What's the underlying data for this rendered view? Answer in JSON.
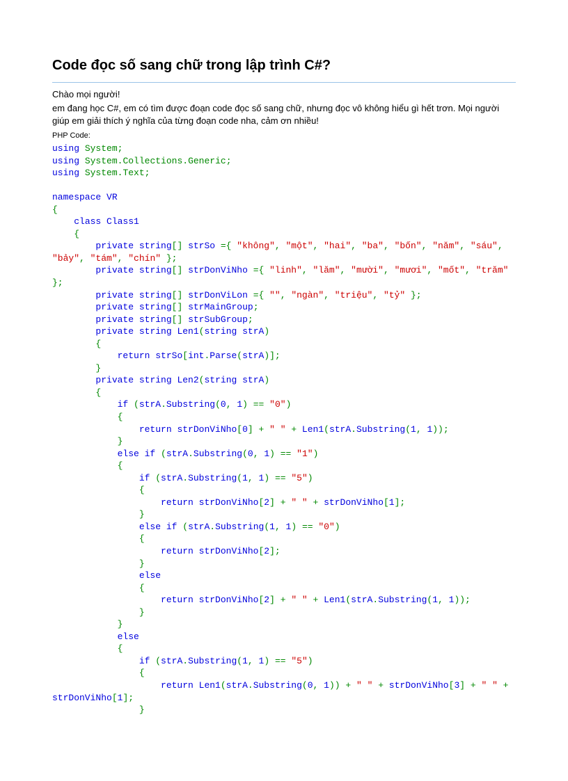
{
  "title": "Code đọc số sang chữ trong lập trình C#?",
  "intro_lines": [
    "Chào mọi người!",
    "em đang học C#, em có tìm được đoạn code đọc số sang chữ, nhưng đọc vô không hiểu gì hết trơn. Mọi người giúp em giải thích ý nghĩa của từng đoạn code nha, cảm ơn nhiều!"
  ],
  "php_label": "PHP Code:",
  "code_tokens": [
    [
      [
        "kw",
        "using"
      ],
      [
        "pl",
        " System"
      ],
      [
        "op",
        ";"
      ]
    ],
    [
      [
        "kw",
        "using"
      ],
      [
        "pl",
        " System"
      ],
      [
        "op",
        "."
      ],
      [
        "pl",
        "Collections"
      ],
      [
        "op",
        "."
      ],
      [
        "pl",
        "Generic"
      ],
      [
        "op",
        ";"
      ]
    ],
    [
      [
        "kw",
        "using"
      ],
      [
        "pl",
        " System"
      ],
      [
        "op",
        "."
      ],
      [
        "pl",
        "Text"
      ],
      [
        "op",
        ";"
      ]
    ],
    [
      [
        "",
        " "
      ]
    ],
    [
      [
        "kw",
        "namespace "
      ],
      [
        "id",
        "VR"
      ]
    ],
    [
      [
        "op",
        "{"
      ]
    ],
    [
      [
        "pl",
        "    "
      ],
      [
        "kw",
        "class "
      ],
      [
        "id",
        "Class1"
      ]
    ],
    [
      [
        "pl",
        "    "
      ],
      [
        "op",
        "{"
      ]
    ],
    [
      [
        "pl",
        "        "
      ],
      [
        "kw",
        "private "
      ],
      [
        "typ",
        "string"
      ],
      [
        "op",
        "[] "
      ],
      [
        "id",
        "strSo "
      ],
      [
        "op",
        "={ "
      ],
      [
        "str",
        "\"không\""
      ],
      [
        "op",
        ", "
      ],
      [
        "str",
        "\"một\""
      ],
      [
        "op",
        ", "
      ],
      [
        "str",
        "\"hai\""
      ],
      [
        "op",
        ", "
      ],
      [
        "str",
        "\"ba\""
      ],
      [
        "op",
        ", "
      ],
      [
        "str",
        "\"bốn\""
      ],
      [
        "op",
        ", "
      ],
      [
        "str",
        "\"năm\""
      ],
      [
        "op",
        ", "
      ],
      [
        "str",
        "\"sáu\""
      ],
      [
        "op",
        ", "
      ],
      [
        "str",
        "\"bảy\""
      ],
      [
        "op",
        ", "
      ],
      [
        "str",
        "\"tám\""
      ],
      [
        "op",
        ", "
      ],
      [
        "str",
        "\"chín\""
      ],
      [
        "op",
        " };"
      ]
    ],
    [
      [
        "pl",
        "        "
      ],
      [
        "kw",
        "private "
      ],
      [
        "typ",
        "string"
      ],
      [
        "op",
        "[] "
      ],
      [
        "id",
        "strDonViNho "
      ],
      [
        "op",
        "={ "
      ],
      [
        "str",
        "\"linh\""
      ],
      [
        "op",
        ", "
      ],
      [
        "str",
        "\"lăm\""
      ],
      [
        "op",
        ", "
      ],
      [
        "str",
        "\"mười\""
      ],
      [
        "op",
        ", "
      ],
      [
        "str",
        "\"mươi\""
      ],
      [
        "op",
        ", "
      ],
      [
        "str",
        "\"mốt\""
      ],
      [
        "op",
        ", "
      ],
      [
        "str",
        "\"trăm\""
      ],
      [
        "op",
        " };"
      ]
    ],
    [
      [
        "pl",
        "        "
      ],
      [
        "kw",
        "private "
      ],
      [
        "typ",
        "string"
      ],
      [
        "op",
        "[] "
      ],
      [
        "id",
        "strDonViLon "
      ],
      [
        "op",
        "={ "
      ],
      [
        "str",
        "\"\""
      ],
      [
        "op",
        ", "
      ],
      [
        "str",
        "\"ngàn\""
      ],
      [
        "op",
        ", "
      ],
      [
        "str",
        "\"triệu\""
      ],
      [
        "op",
        ", "
      ],
      [
        "str",
        "\"tỷ\""
      ],
      [
        "op",
        " };"
      ]
    ],
    [
      [
        "pl",
        "        "
      ],
      [
        "kw",
        "private "
      ],
      [
        "typ",
        "string"
      ],
      [
        "op",
        "[] "
      ],
      [
        "id",
        "strMainGroup"
      ],
      [
        "op",
        ";"
      ]
    ],
    [
      [
        "pl",
        "        "
      ],
      [
        "kw",
        "private "
      ],
      [
        "typ",
        "string"
      ],
      [
        "op",
        "[] "
      ],
      [
        "id",
        "strSubGroup"
      ],
      [
        "op",
        ";"
      ]
    ],
    [
      [
        "pl",
        "        "
      ],
      [
        "kw",
        "private "
      ],
      [
        "typ",
        "string "
      ],
      [
        "mth",
        "Len1"
      ],
      [
        "op",
        "("
      ],
      [
        "typ",
        "string "
      ],
      [
        "id",
        "strA"
      ],
      [
        "op",
        ")"
      ]
    ],
    [
      [
        "pl",
        "        "
      ],
      [
        "op",
        "{"
      ]
    ],
    [
      [
        "pl",
        "            "
      ],
      [
        "kw",
        "return "
      ],
      [
        "id",
        "strSo"
      ],
      [
        "op",
        "["
      ],
      [
        "typ",
        "int"
      ],
      [
        "op",
        "."
      ],
      [
        "mth",
        "Parse"
      ],
      [
        "op",
        "("
      ],
      [
        "id",
        "strA"
      ],
      [
        "op",
        ")];"
      ]
    ],
    [
      [
        "pl",
        "        "
      ],
      [
        "op",
        "}"
      ]
    ],
    [
      [
        "pl",
        "        "
      ],
      [
        "kw",
        "private "
      ],
      [
        "typ",
        "string "
      ],
      [
        "mth",
        "Len2"
      ],
      [
        "op",
        "("
      ],
      [
        "typ",
        "string "
      ],
      [
        "id",
        "strA"
      ],
      [
        "op",
        ")"
      ]
    ],
    [
      [
        "pl",
        "        "
      ],
      [
        "op",
        "{"
      ]
    ],
    [
      [
        "pl",
        "            "
      ],
      [
        "kw",
        "if "
      ],
      [
        "op",
        "("
      ],
      [
        "id",
        "strA"
      ],
      [
        "op",
        "."
      ],
      [
        "mth",
        "Substring"
      ],
      [
        "op",
        "("
      ],
      [
        "num",
        "0"
      ],
      [
        "op",
        ", "
      ],
      [
        "num",
        "1"
      ],
      [
        "op",
        ") == "
      ],
      [
        "str",
        "\"0\""
      ],
      [
        "op",
        ")"
      ]
    ],
    [
      [
        "pl",
        "            "
      ],
      [
        "op",
        "{"
      ]
    ],
    [
      [
        "pl",
        "                "
      ],
      [
        "kw",
        "return "
      ],
      [
        "id",
        "strDonViNho"
      ],
      [
        "op",
        "["
      ],
      [
        "num",
        "0"
      ],
      [
        "op",
        "] + "
      ],
      [
        "str",
        "\" \""
      ],
      [
        "op",
        " + "
      ],
      [
        "mth",
        "Len1"
      ],
      [
        "op",
        "("
      ],
      [
        "id",
        "strA"
      ],
      [
        "op",
        "."
      ],
      [
        "mth",
        "Substring"
      ],
      [
        "op",
        "("
      ],
      [
        "num",
        "1"
      ],
      [
        "op",
        ", "
      ],
      [
        "num",
        "1"
      ],
      [
        "op",
        "));"
      ]
    ],
    [
      [
        "pl",
        "            "
      ],
      [
        "op",
        "}"
      ]
    ],
    [
      [
        "pl",
        "            "
      ],
      [
        "kw",
        "else if "
      ],
      [
        "op",
        "("
      ],
      [
        "id",
        "strA"
      ],
      [
        "op",
        "."
      ],
      [
        "mth",
        "Substring"
      ],
      [
        "op",
        "("
      ],
      [
        "num",
        "0"
      ],
      [
        "op",
        ", "
      ],
      [
        "num",
        "1"
      ],
      [
        "op",
        ") == "
      ],
      [
        "str",
        "\"1\""
      ],
      [
        "op",
        ")"
      ]
    ],
    [
      [
        "pl",
        "            "
      ],
      [
        "op",
        "{"
      ]
    ],
    [
      [
        "pl",
        "                "
      ],
      [
        "kw",
        "if "
      ],
      [
        "op",
        "("
      ],
      [
        "id",
        "strA"
      ],
      [
        "op",
        "."
      ],
      [
        "mth",
        "Substring"
      ],
      [
        "op",
        "("
      ],
      [
        "num",
        "1"
      ],
      [
        "op",
        ", "
      ],
      [
        "num",
        "1"
      ],
      [
        "op",
        ") == "
      ],
      [
        "str",
        "\"5\""
      ],
      [
        "op",
        ")"
      ]
    ],
    [
      [
        "pl",
        "                "
      ],
      [
        "op",
        "{"
      ]
    ],
    [
      [
        "pl",
        "                    "
      ],
      [
        "kw",
        "return "
      ],
      [
        "id",
        "strDonViNho"
      ],
      [
        "op",
        "["
      ],
      [
        "num",
        "2"
      ],
      [
        "op",
        "] + "
      ],
      [
        "str",
        "\" \""
      ],
      [
        "op",
        " + "
      ],
      [
        "id",
        "strDonViNho"
      ],
      [
        "op",
        "["
      ],
      [
        "num",
        "1"
      ],
      [
        "op",
        "];"
      ]
    ],
    [
      [
        "pl",
        "                "
      ],
      [
        "op",
        "}"
      ]
    ],
    [
      [
        "pl",
        "                "
      ],
      [
        "kw",
        "else if "
      ],
      [
        "op",
        "("
      ],
      [
        "id",
        "strA"
      ],
      [
        "op",
        "."
      ],
      [
        "mth",
        "Substring"
      ],
      [
        "op",
        "("
      ],
      [
        "num",
        "1"
      ],
      [
        "op",
        ", "
      ],
      [
        "num",
        "1"
      ],
      [
        "op",
        ") == "
      ],
      [
        "str",
        "\"0\""
      ],
      [
        "op",
        ")"
      ]
    ],
    [
      [
        "pl",
        "                "
      ],
      [
        "op",
        "{"
      ]
    ],
    [
      [
        "pl",
        "                    "
      ],
      [
        "kw",
        "return "
      ],
      [
        "id",
        "strDonViNho"
      ],
      [
        "op",
        "["
      ],
      [
        "num",
        "2"
      ],
      [
        "op",
        "];"
      ]
    ],
    [
      [
        "pl",
        "                "
      ],
      [
        "op",
        "}"
      ]
    ],
    [
      [
        "pl",
        "                "
      ],
      [
        "kw",
        "else"
      ]
    ],
    [
      [
        "pl",
        "                "
      ],
      [
        "op",
        "{"
      ]
    ],
    [
      [
        "pl",
        "                    "
      ],
      [
        "kw",
        "return "
      ],
      [
        "id",
        "strDonViNho"
      ],
      [
        "op",
        "["
      ],
      [
        "num",
        "2"
      ],
      [
        "op",
        "] + "
      ],
      [
        "str",
        "\" \""
      ],
      [
        "op",
        " + "
      ],
      [
        "mth",
        "Len1"
      ],
      [
        "op",
        "("
      ],
      [
        "id",
        "strA"
      ],
      [
        "op",
        "."
      ],
      [
        "mth",
        "Substring"
      ],
      [
        "op",
        "("
      ],
      [
        "num",
        "1"
      ],
      [
        "op",
        ", "
      ],
      [
        "num",
        "1"
      ],
      [
        "op",
        "));"
      ]
    ],
    [
      [
        "pl",
        "                "
      ],
      [
        "op",
        "}"
      ]
    ],
    [
      [
        "pl",
        "            "
      ],
      [
        "op",
        "}"
      ]
    ],
    [
      [
        "pl",
        "            "
      ],
      [
        "kw",
        "else"
      ]
    ],
    [
      [
        "pl",
        "            "
      ],
      [
        "op",
        "{"
      ]
    ],
    [
      [
        "pl",
        "                "
      ],
      [
        "kw",
        "if "
      ],
      [
        "op",
        "("
      ],
      [
        "id",
        "strA"
      ],
      [
        "op",
        "."
      ],
      [
        "mth",
        "Substring"
      ],
      [
        "op",
        "("
      ],
      [
        "num",
        "1"
      ],
      [
        "op",
        ", "
      ],
      [
        "num",
        "1"
      ],
      [
        "op",
        ") == "
      ],
      [
        "str",
        "\"5\""
      ],
      [
        "op",
        ")"
      ]
    ],
    [
      [
        "pl",
        "                "
      ],
      [
        "op",
        "{"
      ]
    ],
    [
      [
        "pl",
        "                    "
      ],
      [
        "kw",
        "return "
      ],
      [
        "mth",
        "Len1"
      ],
      [
        "op",
        "("
      ],
      [
        "id",
        "strA"
      ],
      [
        "op",
        "."
      ],
      [
        "mth",
        "Substring"
      ],
      [
        "op",
        "("
      ],
      [
        "num",
        "0"
      ],
      [
        "op",
        ", "
      ],
      [
        "num",
        "1"
      ],
      [
        "op",
        ")) + "
      ],
      [
        "str",
        "\" \""
      ],
      [
        "op",
        " + "
      ],
      [
        "id",
        "strDonViNho"
      ],
      [
        "op",
        "["
      ],
      [
        "num",
        "3"
      ],
      [
        "op",
        "] + "
      ],
      [
        "str",
        "\" \""
      ],
      [
        "op",
        " + "
      ],
      [
        "id",
        "strDonViNho"
      ],
      [
        "op",
        "["
      ],
      [
        "num",
        "1"
      ],
      [
        "op",
        "];"
      ]
    ],
    [
      [
        "pl",
        "                "
      ],
      [
        "op",
        "}"
      ]
    ]
  ]
}
